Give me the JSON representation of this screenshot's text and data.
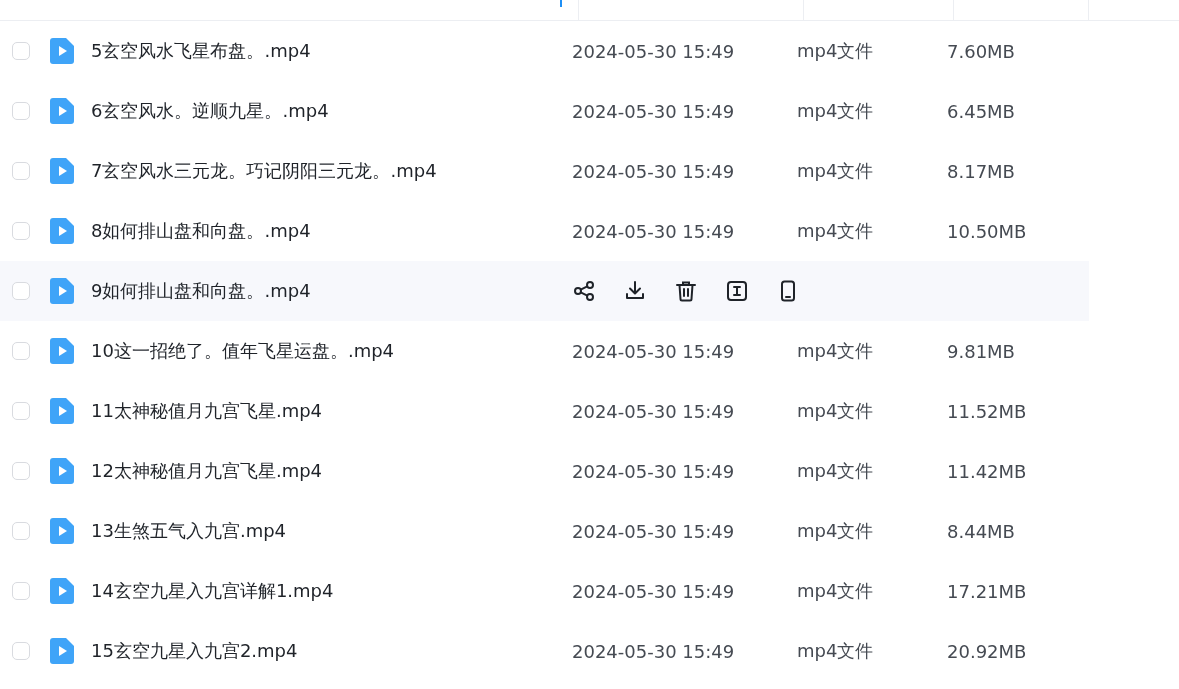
{
  "table": {
    "rows": [
      {
        "name": "5玄空风水飞星布盘。.mp4",
        "modified": "2024-05-30 15:49",
        "type": "mp4文件",
        "size": "7.60MB",
        "checked": false,
        "hovered": false
      },
      {
        "name": "6玄空风水。逆顺九星。.mp4",
        "modified": "2024-05-30 15:49",
        "type": "mp4文件",
        "size": "6.45MB",
        "checked": false,
        "hovered": false
      },
      {
        "name": "7玄空风水三元龙。巧记阴阳三元龙。.mp4",
        "modified": "2024-05-30 15:49",
        "type": "mp4文件",
        "size": "8.17MB",
        "checked": false,
        "hovered": false
      },
      {
        "name": "8如何排山盘和向盘。.mp4",
        "modified": "2024-05-30 15:49",
        "type": "mp4文件",
        "size": "10.50MB",
        "checked": false,
        "hovered": false
      },
      {
        "name": "9如何排山盘和向盘。.mp4",
        "checked": false,
        "hovered": true
      },
      {
        "name": "10这一招绝了。值年飞星运盘。.mp4",
        "modified": "2024-05-30 15:49",
        "type": "mp4文件",
        "size": "9.81MB",
        "checked": false,
        "hovered": false
      },
      {
        "name": "11太神秘值月九宫飞星.mp4",
        "modified": "2024-05-30 15:49",
        "type": "mp4文件",
        "size": "11.52MB",
        "checked": false,
        "hovered": false
      },
      {
        "name": "12太神秘值月九宫飞星.mp4",
        "modified": "2024-05-30 15:49",
        "type": "mp4文件",
        "size": "11.42MB",
        "checked": false,
        "hovered": false
      },
      {
        "name": "13生煞五气入九宫.mp4",
        "modified": "2024-05-30 15:49",
        "type": "mp4文件",
        "size": "8.44MB",
        "checked": false,
        "hovered": false
      },
      {
        "name": "14玄空九星入九宫详解1.mp4",
        "modified": "2024-05-30 15:49",
        "type": "mp4文件",
        "size": "17.21MB",
        "checked": false,
        "hovered": false
      },
      {
        "name": "15玄空九星入九宫2.mp4",
        "modified": "2024-05-30 15:49",
        "type": "mp4文件",
        "size": "20.92MB",
        "checked": false,
        "hovered": false
      }
    ]
  }
}
